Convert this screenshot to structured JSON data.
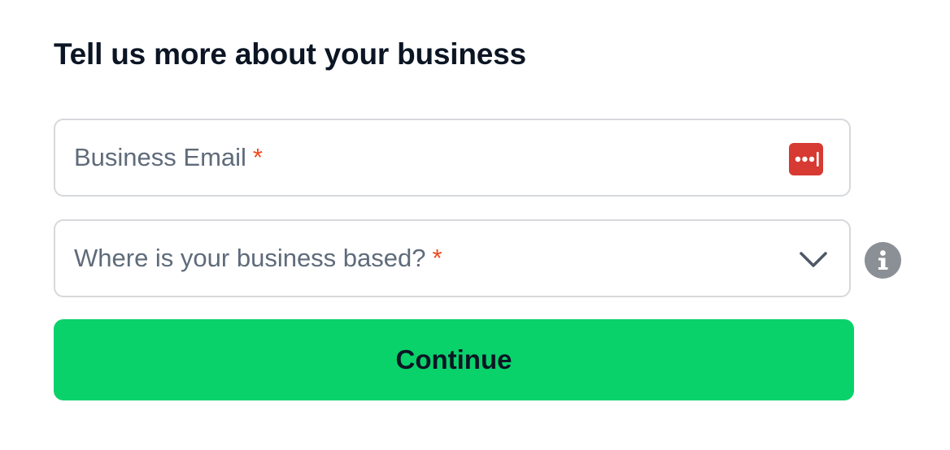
{
  "heading": "Tell us more about your business",
  "email_field": {
    "label": "Business Email",
    "required_mark": "*",
    "value": "",
    "autofill_icon": "password-manager-icon"
  },
  "location_field": {
    "label": "Where is your business based?",
    "required_mark": "*",
    "selected_value": "",
    "dropdown_icon": "chevron-down-icon",
    "help_icon": "info-icon"
  },
  "continue_button": {
    "label": "Continue"
  },
  "colors": {
    "accent": "#0ad26b",
    "required": "#ee4a1c",
    "password_manager": "#d63a33",
    "info": "#8b9097"
  }
}
